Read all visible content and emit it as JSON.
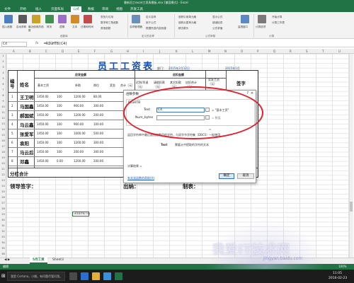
{
  "window": {
    "title": "最新员工excel工资表模板.xlsx  [兼容模式] - Excel",
    "tabs": [
      "文件",
      "开始",
      "插入",
      "页面布局",
      "公式",
      "数据",
      "审阅",
      "视图",
      "开发工具"
    ],
    "active_tab": "公式"
  },
  "ribbon": {
    "buttons": [
      "插入函数",
      "自动求和",
      "最近使用的函数",
      "财务",
      "逻辑",
      "文本",
      "日期和时间",
      "查找与引用",
      "数学和三角函数",
      "其他函数",
      "名称管理器",
      "定义名称",
      "用于公式",
      "根据所选内容创建",
      "追踪引用单元格",
      "追踪从属单元格",
      "移去箭头",
      "显示公式",
      "错误检查",
      "公式求值",
      "监视窗口",
      "计算选项",
      "开始计算",
      "计算工作表"
    ],
    "groups": [
      "函数库",
      "定义的名称",
      "公式审核",
      "计算"
    ]
  },
  "formula_bar": {
    "name_box": "C4",
    "formula": "=RIGHTB(C4)",
    "fx": "fx"
  },
  "columns": [
    "A",
    "B",
    "C",
    "D",
    "E",
    "F",
    "G",
    "H",
    "I",
    "J",
    "K",
    "L",
    "M",
    "N",
    "O",
    "P",
    "Q",
    "R",
    "S",
    "T",
    "U"
  ],
  "rows": [
    "1",
    "2",
    "3",
    "4",
    "5",
    "6",
    "7",
    "8",
    "9",
    "10",
    "11",
    "12",
    "13",
    "14",
    "15",
    "16",
    "17",
    "18",
    "19",
    "20",
    "21",
    "22",
    "23",
    "24",
    "25",
    "26",
    "27",
    "28",
    "29",
    "30",
    "31",
    "32",
    "33",
    "34",
    "35",
    "36",
    "37"
  ],
  "sheet": {
    "title": "员工工资表",
    "dept_label": "部门：",
    "date1": "2015年2月12日",
    "date2": "2015年1月",
    "headers": {
      "num": "编号",
      "name": "姓名",
      "should": "应发金额",
      "deduct": "应扣金额",
      "basic": "基本工资",
      "post": "岗位",
      "subsidy": "补助",
      "bonus": "奖金",
      "total": "合计（元）",
      "late": "迟到/早退（元）",
      "leave": "请假扣款（元）",
      "other": "其它扣款（元）",
      "dtotal": "应扣合计（元）",
      "actual": "实发工资（元）",
      "sign": "签字"
    },
    "employees": [
      {
        "no": "1",
        "name": "王卫明",
        "basic": "1450.00",
        "a": "100",
        "b": "1200.00",
        "c": "80.00"
      },
      {
        "no": "2",
        "name": "马国鑫",
        "basic": "1450.00",
        "a": "100",
        "b": "900.00",
        "c": "300.00"
      },
      {
        "no": "3",
        "name": "郝国斌",
        "basic": "1450.00",
        "a": "100",
        "b": "1200.00",
        "c": "200.00"
      },
      {
        "no": "4",
        "name": "马云鑫",
        "basic": "1450.00",
        "a": "100",
        "b": "900.00",
        "c": "100.00"
      },
      {
        "no": "5",
        "name": "张爱军",
        "basic": "1450.00",
        "a": "100",
        "b": "1000.00",
        "c": "500.00"
      },
      {
        "no": "6",
        "name": "袁阳",
        "basic": "1450.00",
        "a": "100",
        "b": "1200.00",
        "c": "300.00"
      },
      {
        "no": "7",
        "name": "马云后",
        "basic": "1450.00",
        "a": "100",
        "b": "200.00",
        "c": "300.00"
      },
      {
        "no": "8",
        "name": "邓鑫",
        "basic": "1450.00",
        "a": "0.00",
        "b": "1200.00",
        "c": "200.00"
      }
    ],
    "subtotal": "分栏合计",
    "footer": {
      "leader": "领导签字：",
      "cashier": "出纳：",
      "maker": "制表："
    },
    "editing_cell": "=RIGHTB(C4)"
  },
  "dialog": {
    "title": "函数参数",
    "function": "RIGHTB",
    "arg1_label": "Text",
    "arg1_value": "C4",
    "arg1_result": "= \"基本工资\"",
    "arg2_label": "Num_bytes",
    "arg2_result": "= 数值",
    "eq": "=",
    "desc": "返回字符串中最后面指定数目的字符，与双字节字符集（DBCS）一起使用",
    "arg_desc_label": "Text",
    "arg_desc": "需要从中提取的字符的文本",
    "result_label": "计算结果 =",
    "help_link": "有关该函数的帮助(H)",
    "ok": "确定",
    "cancel": "取消",
    "help_icon": "?",
    "close_icon": "×"
  },
  "sheet_tabs": [
    "5月工资",
    "Sheet3"
  ],
  "status": {
    "mode": "编辑",
    "zoom": "100%"
  },
  "taskbar": {
    "search": "我是 Cortana，小娜。有问题尽管问我。",
    "time": "11:05",
    "date": "2016-02-23"
  },
  "watermark": {
    "text": "我爱IT技术网",
    "sub": "jingyan.baidu.com"
  },
  "colors": {
    "accent": "#217346",
    "highlight": "#e0202e",
    "title": "#1a4ea8"
  }
}
